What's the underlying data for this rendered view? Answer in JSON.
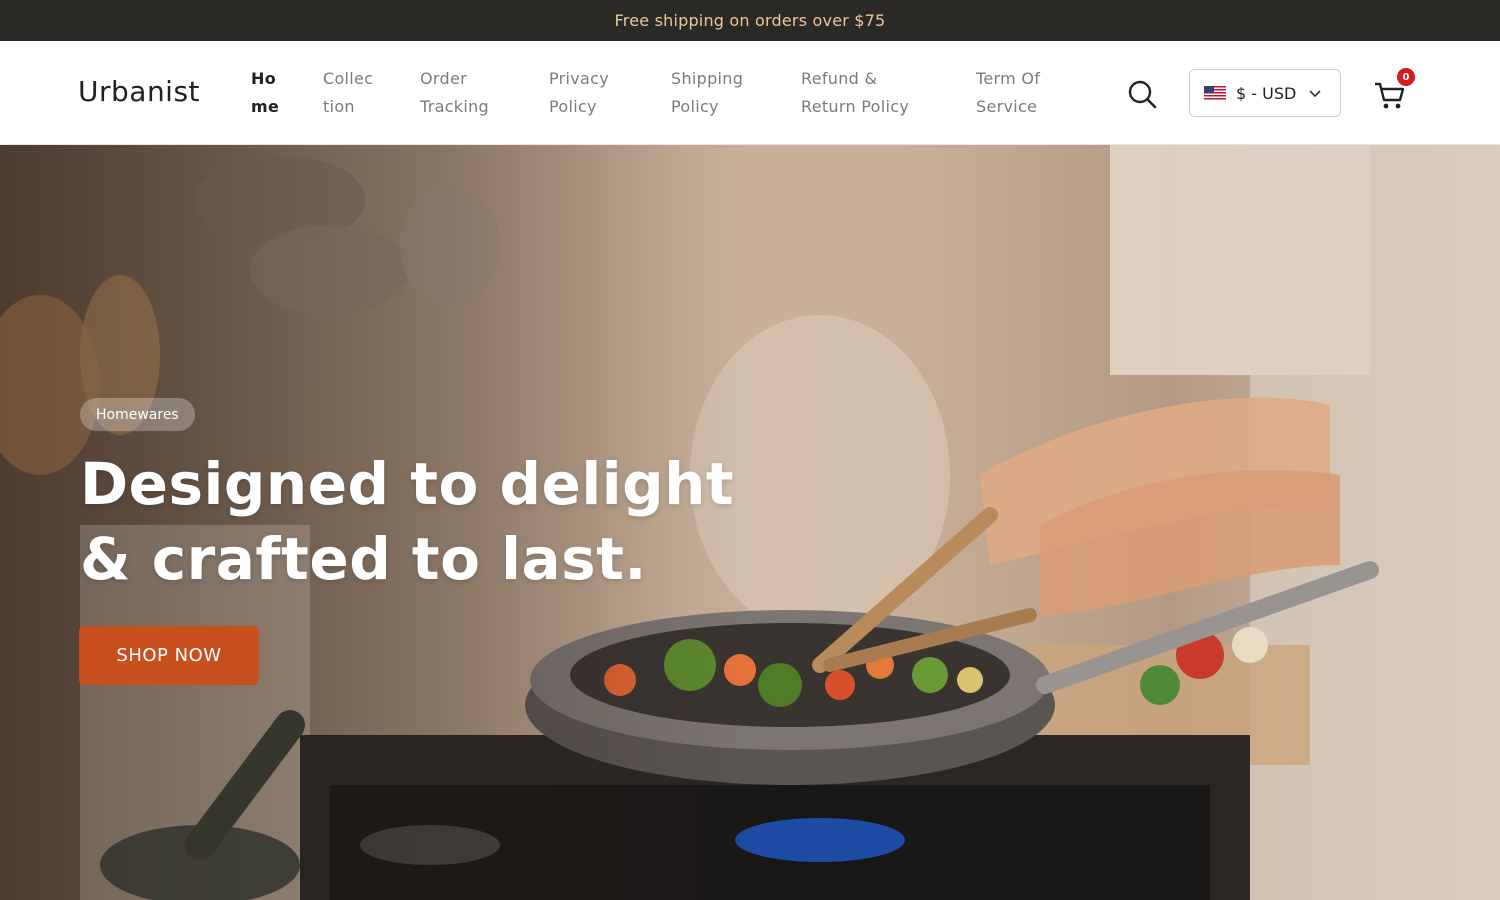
{
  "announcement": {
    "text": "Free shipping on orders over $75"
  },
  "header": {
    "logo": "Urbanist",
    "nav": [
      {
        "line1": "Ho",
        "line2": "me",
        "active": true
      },
      {
        "line1": "Collec",
        "line2": "tion",
        "active": false
      },
      {
        "line1": "Order",
        "line2": "Tracking",
        "active": false
      },
      {
        "line1": "Privacy",
        "line2": "Policy",
        "active": false
      },
      {
        "line1": "Shipping",
        "line2": "Policy",
        "active": false
      },
      {
        "line1": "Refund &",
        "line2": "Return Policy",
        "active": false
      },
      {
        "line1": "Term Of",
        "line2": "Service",
        "active": false
      }
    ],
    "currency": {
      "label": "$ - USD",
      "flag": "us-flag-icon"
    },
    "cart": {
      "count": "0"
    },
    "icons": {
      "search": "search-icon",
      "cart": "cart-icon",
      "dropdown": "chevron-down-icon"
    }
  },
  "hero": {
    "tag": "Homewares",
    "headline_line1": "Designed to delight",
    "headline_line2": "& crafted to last.",
    "cta": "SHOP NOW",
    "image": "woman-cooking-vegetables-in-pan-on-gas-stove"
  },
  "colors": {
    "announcement_bg": "#2b2926",
    "announcement_text": "#e8c89b",
    "cta_bg": "#c8501f",
    "badge_bg": "#d41d1d"
  }
}
